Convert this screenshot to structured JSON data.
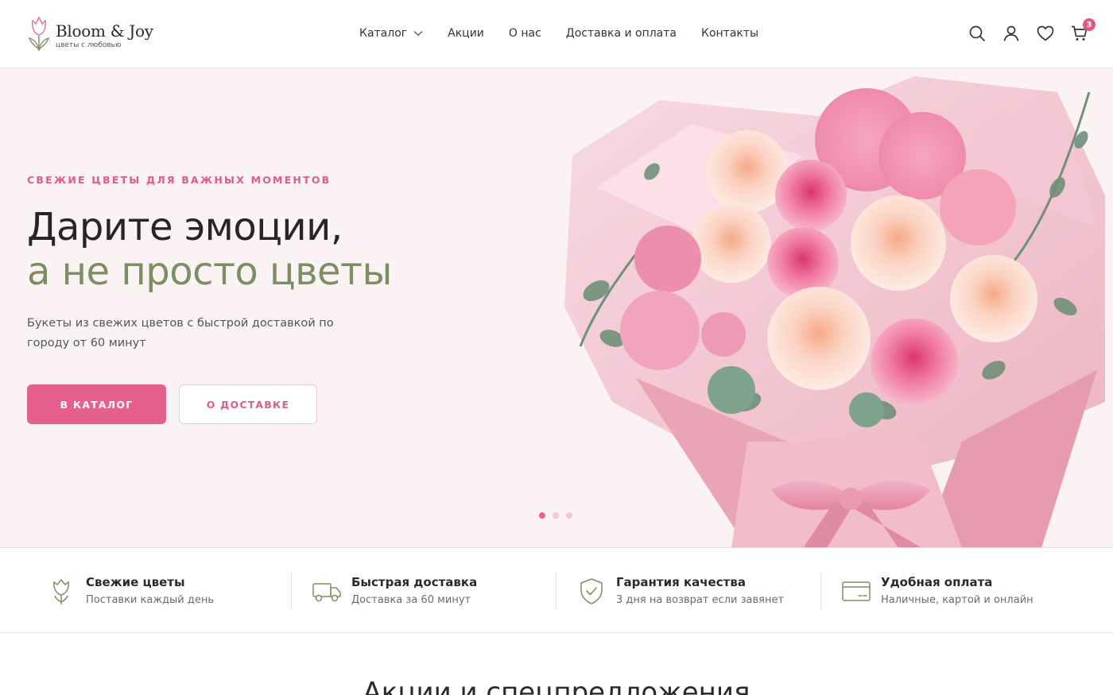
{
  "brand": {
    "name": "Bloom & Joy",
    "tagline": "цветы с любовью",
    "logo_icon": "tulip-icon",
    "accent": "#e6608e",
    "green": "#7b8f63"
  },
  "nav": {
    "items": [
      {
        "label": "Каталог",
        "has_dropdown": true
      },
      {
        "label": "Акции"
      },
      {
        "label": "О нас"
      },
      {
        "label": "Доставка и оплата"
      },
      {
        "label": "Контакты"
      }
    ]
  },
  "header_icons": {
    "search": "search-icon",
    "account": "user-icon",
    "favorites": "heart-icon",
    "cart": "cart-icon",
    "cart_count": "3"
  },
  "hero": {
    "eyebrow": "СВЕЖИЕ ЦВЕТЫ ДЛЯ ВАЖНЫХ МОМЕНТОВ",
    "title_line1": "Дарите эмоции,",
    "title_line2": "а не просто цветы",
    "subtitle": "Букеты из свежих цветов с быстрой доставкой по городу от 60 минут",
    "primary_button": "В КАТАЛОГ",
    "secondary_button": "О ДОСТАВКЕ",
    "slides_total": 3,
    "active_slide": 1
  },
  "features": [
    {
      "icon": "flower-icon",
      "title": "Свежие цветы",
      "desc": "Поставки каждый день"
    },
    {
      "icon": "truck-icon",
      "title": "Быстрая доставка",
      "desc": "Доставка за 60 минут"
    },
    {
      "icon": "shield-check-icon",
      "title": "Гарантия качества",
      "desc": "3 дня на возврат если завянет"
    },
    {
      "icon": "credit-card-icon",
      "title": "Удобная оплата",
      "desc": "Наличные, картой и онлайн"
    }
  ],
  "next_section": {
    "title": "Акции и спецпредложения"
  }
}
